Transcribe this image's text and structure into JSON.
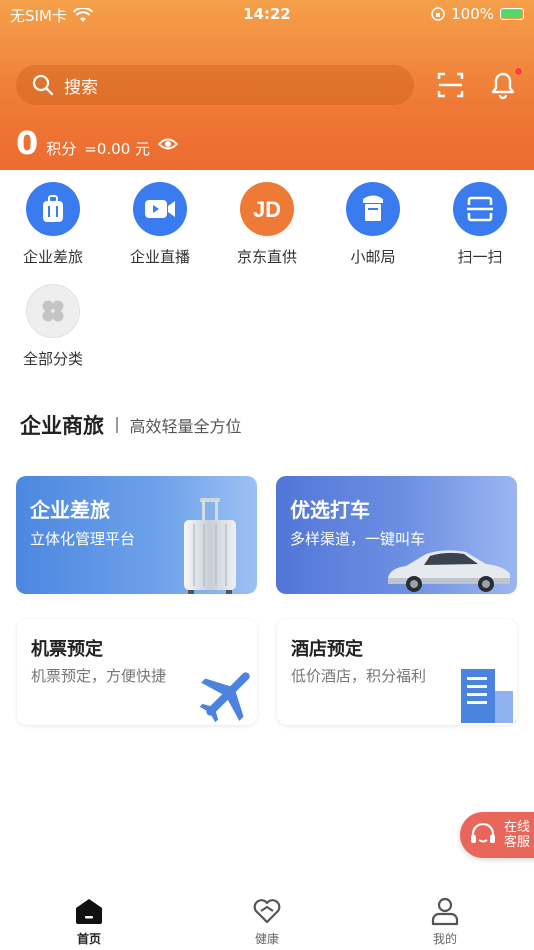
{
  "status_bar": {
    "carrier": "无SIM卡",
    "time": "14:22",
    "battery": "100%"
  },
  "header": {
    "search_placeholder": "搜索",
    "points_value": "0",
    "points_label": "积分",
    "points_money": "=0.00 元"
  },
  "quick_menu": [
    {
      "label": "企业差旅",
      "icon": "luggage-icon",
      "color": "#3a7bf0"
    },
    {
      "label": "企业直播",
      "icon": "video-camera-icon",
      "color": "#3a7bf0"
    },
    {
      "label": "京东直供",
      "icon": "jd-icon",
      "color": "#ef7a35"
    },
    {
      "label": "小邮局",
      "icon": "mailbox-icon",
      "color": "#3a7bf0"
    },
    {
      "label": "扫一扫",
      "icon": "scan-icon",
      "color": "#3a7bf0"
    },
    {
      "label": "全部分类",
      "icon": "category-icon",
      "color": "#eeeeee"
    }
  ],
  "section": {
    "title": "企业商旅",
    "subtitle": "高效轻量全方位"
  },
  "cards": [
    {
      "title": "企业差旅",
      "subtitle": "立体化管理平台"
    },
    {
      "title": "优选打车",
      "subtitle": "多样渠道，一键叫车"
    },
    {
      "title": "机票预定",
      "subtitle": "机票预定，方便快捷"
    },
    {
      "title": "酒店预定",
      "subtitle": "低价酒店，积分福利"
    }
  ],
  "customer_service": {
    "line1": "在线",
    "line2": "客服"
  },
  "tabbar": [
    {
      "label": "首页",
      "icon": "home-icon",
      "active": true
    },
    {
      "label": "健康",
      "icon": "heart-icon",
      "active": false
    },
    {
      "label": "我的",
      "icon": "user-icon",
      "active": false
    }
  ]
}
